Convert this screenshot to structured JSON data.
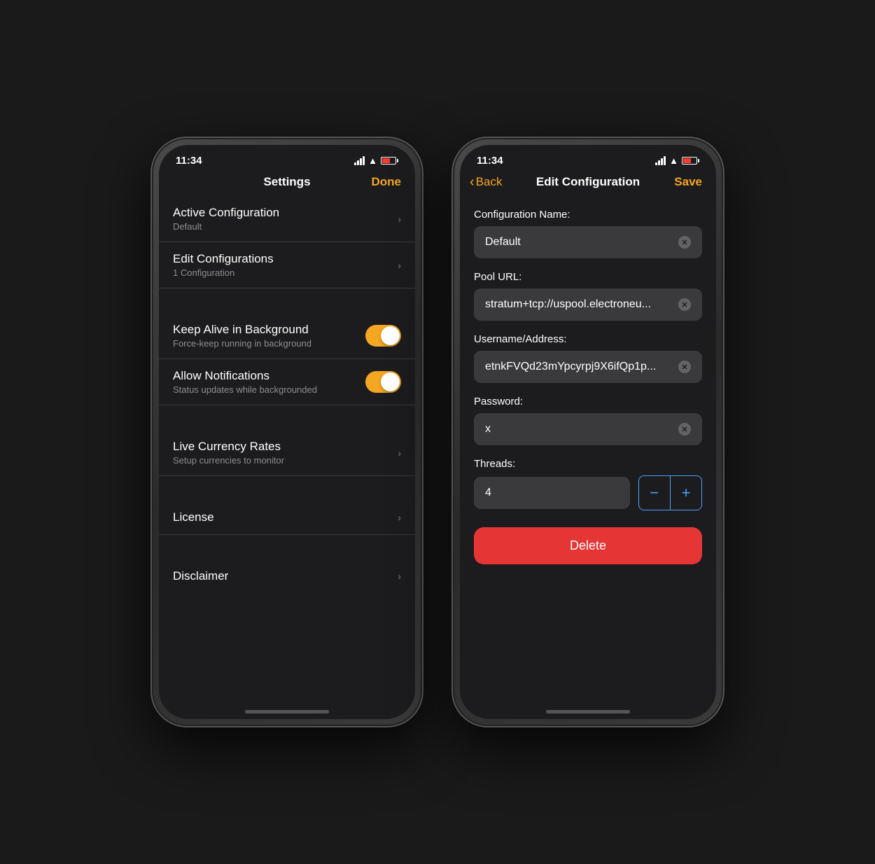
{
  "left_phone": {
    "status": {
      "time": "11:34",
      "save_label": "Done"
    },
    "header": {
      "title": "Settings",
      "action": "Done"
    },
    "rows": [
      {
        "id": "active-config",
        "title": "Active Configuration",
        "subtitle": "Default",
        "type": "nav"
      },
      {
        "id": "edit-configs",
        "title": "Edit Configurations",
        "subtitle": "1 Configuration",
        "type": "nav"
      },
      {
        "id": "keep-alive",
        "title": "Keep Alive in Background",
        "subtitle": "Force-keep running in background",
        "type": "toggle",
        "value": true
      },
      {
        "id": "notifications",
        "title": "Allow Notifications",
        "subtitle": "Status updates while backgrounded",
        "type": "toggle",
        "value": true
      },
      {
        "id": "live-currency",
        "title": "Live Currency Rates",
        "subtitle": "Setup currencies to monitor",
        "type": "nav"
      },
      {
        "id": "license",
        "title": "License",
        "subtitle": "",
        "type": "nav"
      },
      {
        "id": "disclaimer",
        "title": "Disclaimer",
        "subtitle": "",
        "type": "nav"
      }
    ]
  },
  "right_phone": {
    "status": {
      "time": "11:34"
    },
    "header": {
      "back_label": "Back",
      "title": "Edit Configuration",
      "save_label": "Save"
    },
    "fields": {
      "config_name_label": "Configuration Name:",
      "config_name_value": "Default",
      "pool_url_label": "Pool URL:",
      "pool_url_value": "stratum+tcp://uspool.electroneu...",
      "username_label": "Username/Address:",
      "username_value": "etnkFVQd23mYpcyrpj9X6ifQp1p...",
      "password_label": "Password:",
      "password_value": "x",
      "threads_label": "Threads:",
      "threads_value": "4",
      "stepper_minus": "−",
      "stepper_plus": "+",
      "delete_label": "Delete"
    }
  },
  "icons": {
    "chevron_right": "›",
    "chevron_back": "‹",
    "clear": "✕"
  },
  "colors": {
    "accent": "#f5a623",
    "delete_red": "#e53535",
    "stepper_blue": "#4a9eff",
    "toggle_on": "#f5a623"
  }
}
